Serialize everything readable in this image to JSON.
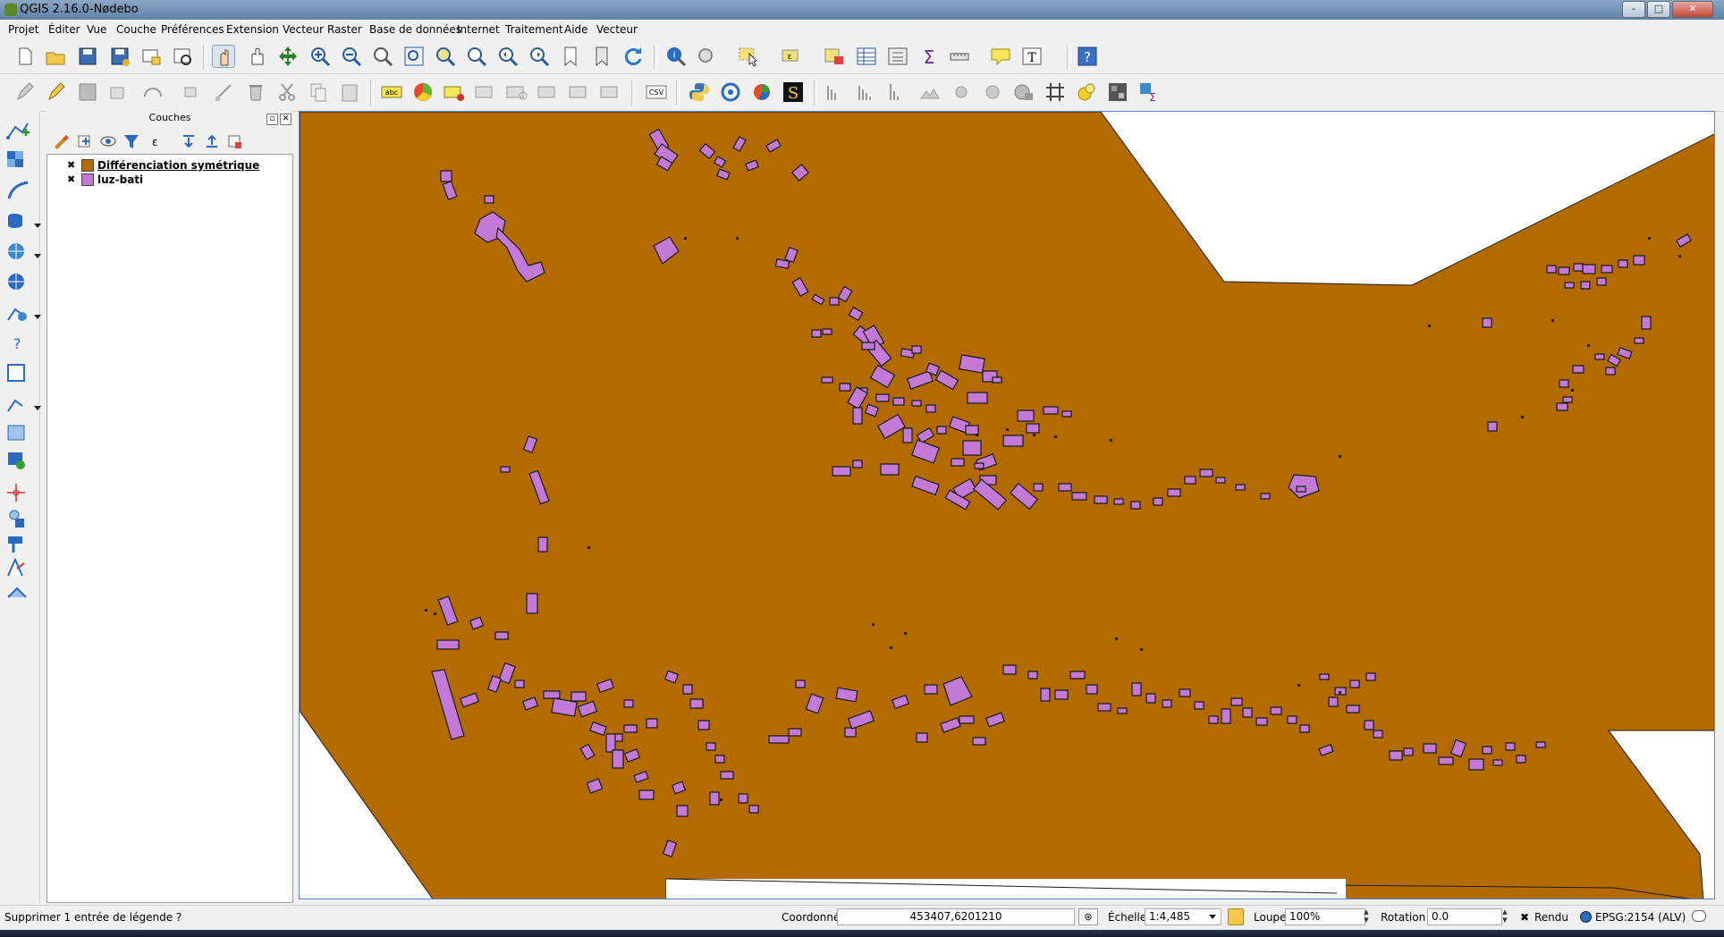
{
  "window": {
    "title": "QGIS 2.16.0-Nødebo",
    "buttons": {
      "minimize": "–",
      "maximize": "□",
      "close": "✕"
    }
  },
  "menu": [
    "Projet",
    "Éditer",
    "Vue",
    "Couche",
    "Préférences",
    "Extension",
    "Vecteur",
    "Raster",
    "Base de données",
    "Internet",
    "Traitement",
    "Aide",
    "Vecteur"
  ],
  "toolbar1": {
    "help_label": "?",
    "label_tool": "T"
  },
  "toolbar2": {
    "csv_label": "CSV",
    "abc_label": "abc"
  },
  "layers_panel": {
    "title": "Couches",
    "layers": [
      {
        "name": "Différenciation symétrique",
        "checked": "✖",
        "color": "#b36b00",
        "selected": true
      },
      {
        "name": "luz-bati",
        "checked": "✖",
        "color": "#c27ad6",
        "selected": false
      }
    ]
  },
  "map": {
    "background": "#ffffff",
    "polygon_fill": "#b36b00",
    "building_fill": "#c27ad6",
    "outline": "#1a1a1a"
  },
  "statusbar": {
    "message": "Supprimer 1 entrée de légende ?",
    "coord_label": "Coordonnée",
    "coord_value": "453407,6201210",
    "scale_label": "Échelle",
    "scale_value": "1:4,485",
    "magnifier_label": "Loupe",
    "magnifier_value": "100%",
    "rotation_label": "Rotation",
    "rotation_value": "0.0",
    "render_label": "Rendu",
    "render_checked": "✖",
    "crs": "EPSG:2154 (ALV)"
  }
}
